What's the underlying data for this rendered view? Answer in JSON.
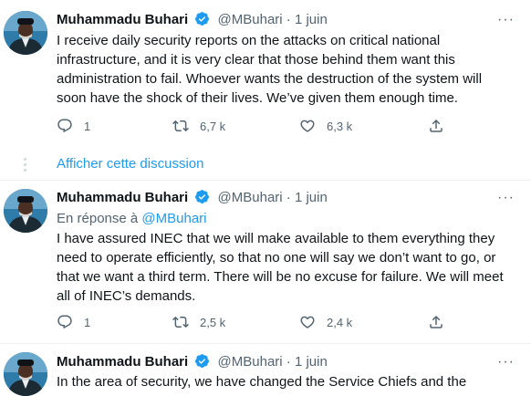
{
  "tweets": [
    {
      "name": "Muhammadu Buhari",
      "handle": "@MBuhari",
      "dot": "·",
      "date": "1 juin",
      "reply_to_prefix": "",
      "reply_to_handle": "",
      "text": "I receive daily security reports on the attacks on critical national infrastructure, and it is very clear that those behind them want this administration to fail. Whoever wants the destruction of the system will soon have the shock of their lives. We’ve given them enough time.",
      "replies": "1",
      "retweets": "6,7 k",
      "likes": "6,3 k"
    },
    {
      "name": "Muhammadu Buhari",
      "handle": "@MBuhari",
      "dot": "·",
      "date": "1 juin",
      "reply_to_prefix": "En réponse à",
      "reply_to_handle": "@MBuhari",
      "text": "I have assured INEC that we will make available to them everything they need to operate efficiently, so that no one will say we don’t want to go, or that we want a third term. There will be no excuse for failure. We will meet all of INEC’s demands.",
      "replies": "1",
      "retweets": "2,5 k",
      "likes": "2,4 k"
    },
    {
      "name": "Muhammadu Buhari",
      "handle": "@MBuhari",
      "dot": "·",
      "date": "1 juin",
      "text": "In the area of security, we have changed the Service Chiefs and the"
    }
  ],
  "show_thread": "Afficher cette discussion",
  "more_label": "···",
  "colors": {
    "accent": "#1d9bf0",
    "muted": "#536471",
    "text": "#0f1419"
  },
  "icons": [
    "avatar",
    "verified-badge-icon",
    "reply-icon",
    "retweet-icon",
    "like-icon",
    "share-icon",
    "more-icon"
  ]
}
